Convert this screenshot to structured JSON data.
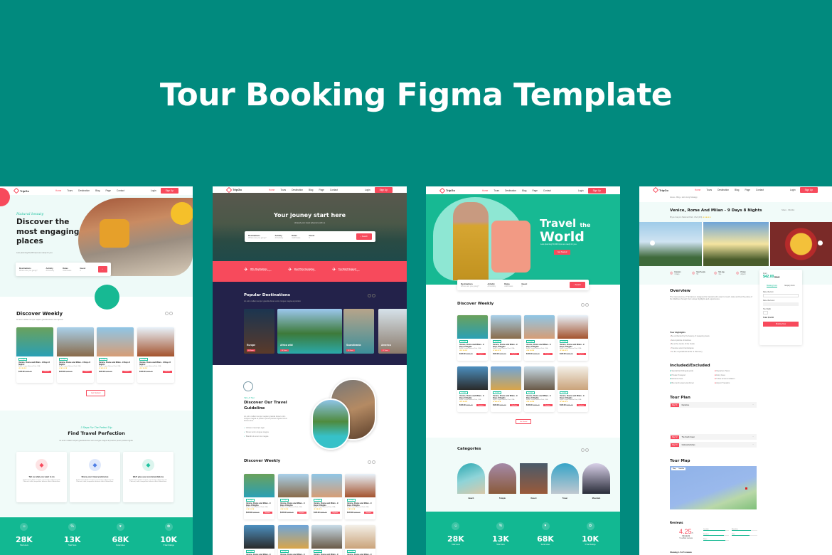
{
  "title": "Tour Booking Figma Template",
  "colors": {
    "background": "#018a7e",
    "accent": "#f74a5c",
    "green": "#12b892",
    "mint": "#eefaf8",
    "navy": "#23224a"
  },
  "nav": {
    "logo": "TripGo",
    "links": [
      "Home",
      "Tours",
      "Destination",
      "Blog",
      "Page",
      "Contact"
    ],
    "login": "Login",
    "signup": "Sign Up"
  },
  "card": {
    "tag": "3 Days",
    "title": "Venice, Rome and Milan - 9 Days 8 Nights",
    "location": "Bryce Canyon National Park, USA",
    "stars": "★★★★★",
    "price": "$120.99",
    "old_price": "$150.00",
    "button": "Explore"
  },
  "get_started": "Get Started",
  "stats": [
    {
      "icon": "users-icon",
      "glyph": "☺",
      "value": "28K",
      "label": "Total Users"
    },
    {
      "icon": "percent-icon",
      "glyph": "%",
      "value": "13K",
      "label": "Total Tours"
    },
    {
      "icon": "thumb-icon",
      "glyph": "♥",
      "value": "68K",
      "label": "Social Likes"
    },
    {
      "icon": "star-icon",
      "glyph": "✿",
      "value": "10K",
      "label": "5 Star Ratings"
    }
  ],
  "p1": {
    "script": "Natural beauty",
    "heading": "Discover the most engaging places",
    "sub": "Less planning 50,000 trips are ready for you.",
    "search": [
      {
        "label": "Destinations",
        "ph": "Where are you going?"
      },
      {
        "label": "Activity",
        "ph": "All Activity"
      },
      {
        "label": "Dates",
        "ph": "Add Dates"
      },
      {
        "label": "Guest",
        "ph": "0"
      }
    ],
    "weekly": "Discover Weekly",
    "weekly_sub": "Ac enim nullam tempor sapien gravida donec enim ipsum",
    "perfect_script": "3 Steps For The Perfect Trip",
    "perfect": "Find Travel Perfection",
    "perfect_sub": "Ac enim nullam tempor gravida donec enim congue magna at pretium purus pretium ligula",
    "steps": [
      {
        "icon": "suitcase-icon",
        "title": "Tell us what you want to do"
      },
      {
        "icon": "taxi-icon",
        "title": "Share your travel preference"
      },
      {
        "icon": "route-icon",
        "title": "We'll give you recommendations"
      }
    ],
    "step_text": "Fuda laoreet dolor sit amet, consectetur adipiscing elit. Placerat, nulla, temporibus dolores officiis laboriosam."
  },
  "p2": {
    "hero": "Your jouney start here",
    "hero_sub": "Unleash your travel adventure with us",
    "search_btn": "Search",
    "features": [
      {
        "icon": "plane-icon",
        "title": "400+ Destinations",
        "sub": "Lorem sed do eiusmod tempor"
      },
      {
        "icon": "clock-icon",
        "title": "Best Price Guarantee",
        "sub": "Lorem sed do eiusmod tempor"
      },
      {
        "icon": "support-icon",
        "title": "Top Notch Support",
        "sub": "Lorem sed do eiusmod tempor"
      }
    ],
    "popular": "Popular Destinations",
    "popular_sub": "Ac enim nullam tempor gravida donec enim congue magna at pretium",
    "destinations": [
      {
        "name": "Europe",
        "tours": "15 Tours"
      },
      {
        "name": "Africa wild",
        "tours": "08 Tours"
      },
      {
        "name": "Scandinavia",
        "tours": "10 Tours"
      },
      {
        "name": "America",
        "tours": "12 Tours"
      }
    ],
    "guide_script": "Tips & Tour",
    "guide": "Discover Our Travel Guideline",
    "guide_text": "Ac enim nullam tempor sapien gravida donec enim congue magna at pretium purus pretium ligula rutrum luctus risus.",
    "guide_list": [
      "Various travel tips tiger",
      "Donec enim congue magna",
      "Blandit sit amet non magna"
    ],
    "weekly": "Discover Weekly"
  },
  "p3": {
    "hero1": "Travel",
    "hero_the": "the",
    "hero2": "World",
    "hero_sub": "Less planning 50,000 trips are ready for you.",
    "cta": "Get Started",
    "weekly": "Discover Weekly",
    "categories": "Categories",
    "cat_list": [
      "Beach",
      "Temple",
      "Desert",
      "Tower",
      "Mountain"
    ]
  },
  "p4": {
    "breadcrumb": [
      "Home",
      "Blog",
      "Hot Living Strategy"
    ],
    "title": "Venice, Rome And Milan - 9 Days 8 Nights",
    "location": "Bryce Canyon National Park, USA",
    "reviews_badge": "(4.8)",
    "share": "Share",
    "wishlist": "Wishlist",
    "info": [
      {
        "k": "Duration",
        "v": "3 days"
      },
      {
        "k": "Max People",
        "v": "50"
      },
      {
        "k": "Min Age",
        "v": "12+"
      },
      {
        "k": "Pickup",
        "v": "Airport"
      }
    ],
    "from": "From",
    "price": "$42.00",
    "old_price": "$60.00",
    "tabs": [
      "Booking Form",
      "Enquiry Form"
    ],
    "date_in": "Date check-in",
    "date_out": "Date check-out",
    "tour_night": "Tour Night",
    "total": "Total: $ 42.00",
    "book": "Booking Now",
    "overview": "Overview",
    "overview_text": "The travel journey of Tanzania is designed for travelers who want to touch, taste and feel the pulse of the Maldives through their unique highlights and experiences.",
    "highlights": "Tour Highlights",
    "highlight_items": [
      "Be enchanted by the beauty of sweeping views",
      "Scout pristine shorelines",
      "Be at the centre of the hustle",
      "Traverse scenic landscapes",
      "Go the unparalleled lands of discovery"
    ],
    "included": "Included/Excluded",
    "inc": [
      "Specialized bilingual guide",
      "Private Transport",
      "Entrance fees",
      "Box lunch water and dinner"
    ],
    "exc": [
      "Departure Taxes",
      "Entry Fees",
      "5 Star Accommodation",
      "Airport Transfers"
    ],
    "plan": "Tour Plan",
    "days": [
      {
        "d": "Day 01",
        "t": "Departure"
      },
      {
        "d": "Day 02",
        "t": "The South Coast"
      },
      {
        "d": "Day 03",
        "t": "Optional Activities"
      }
    ],
    "map": "Tour Map",
    "map_tabs": [
      "Map",
      "Satellite"
    ],
    "reviews": "Reviews",
    "score": "4.25",
    "score_max": "/5",
    "score_label": "Wonderful",
    "score_sub": "5 verified reviews",
    "bars": [
      "Location",
      "Amenities",
      "Services",
      "Price",
      "Room"
    ],
    "showing": "Showing 1-5 of 5 reviews"
  }
}
